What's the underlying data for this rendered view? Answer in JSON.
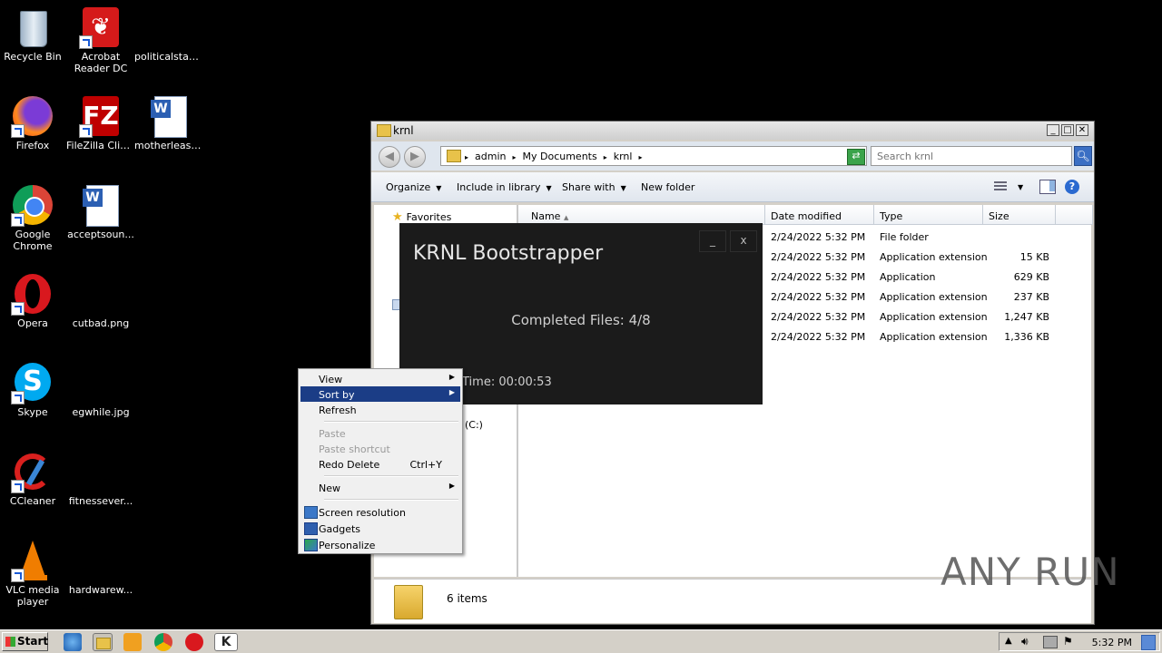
{
  "desktop": {
    "icons": [
      {
        "label": "Recycle Bin",
        "name": "recycle-bin-icon"
      },
      {
        "label": "Acrobat\nReader DC",
        "label1": "Acrobat",
        "label2": "Reader DC",
        "name": "acrobat-reader-icon"
      },
      {
        "label": "politicalstan...",
        "name": "file-icon"
      },
      {
        "label": "Firefox",
        "name": "firefox-icon"
      },
      {
        "label": "FileZilla Client",
        "name": "filezilla-icon"
      },
      {
        "label": "motherleast...",
        "name": "word-document-icon"
      },
      {
        "label1": "Google",
        "label2": "Chrome",
        "name": "chrome-icon"
      },
      {
        "label": "acceptsoun...",
        "name": "word-document-icon"
      },
      {
        "label": "Opera",
        "name": "opera-icon"
      },
      {
        "label": "cutbad.png",
        "name": "image-file-icon"
      },
      {
        "label": "Skype",
        "name": "skype-icon"
      },
      {
        "label": "egwhile.jpg",
        "name": "image-file-icon"
      },
      {
        "label": "CCleaner",
        "name": "ccleaner-icon"
      },
      {
        "label": "fitnessever...",
        "name": "file-icon"
      },
      {
        "label1": "VLC media",
        "label2": "player",
        "name": "vlc-icon"
      },
      {
        "label": "hardwarew...",
        "name": "file-icon"
      }
    ]
  },
  "explorer": {
    "title": "krnl",
    "breadcrumbs": [
      "admin",
      "My Documents",
      "krnl"
    ],
    "search_placeholder": "Search krnl",
    "commands": [
      "Organize",
      "Include in library",
      "Share with",
      "New folder"
    ],
    "nav": {
      "favorites": "Favorites",
      "drive_fragment": "(C:)"
    },
    "columns": [
      "Name",
      "Date modified",
      "Type",
      "Size"
    ],
    "rows": [
      {
        "date": "2/24/2022 5:32 PM",
        "type": "File folder",
        "size": ""
      },
      {
        "date": "2/24/2022 5:32 PM",
        "type": "Application extension",
        "size": "15 KB"
      },
      {
        "date": "2/24/2022 5:32 PM",
        "type": "Application",
        "size": "629 KB"
      },
      {
        "date": "2/24/2022 5:32 PM",
        "type": "Application extension",
        "size": "237 KB"
      },
      {
        "date": "2/24/2022 5:32 PM",
        "type": "Application extension",
        "size": "1,247 KB"
      },
      {
        "date": "2/24/2022 5:32 PM",
        "type": "Application extension",
        "size": "1,336 KB"
      }
    ],
    "item_count": "6 items"
  },
  "krnl": {
    "title": "KRNL Bootstrapper",
    "minimize": "_",
    "close": "x",
    "status": "Completed Files: 4/8",
    "time": "Time: 00:00:53"
  },
  "context_menu": {
    "items": [
      {
        "label": "View",
        "submenu": true
      },
      {
        "label": "Sort by",
        "submenu": true,
        "selected": true
      },
      {
        "label": "Refresh"
      },
      {
        "label": "Paste",
        "disabled": true
      },
      {
        "label": "Paste shortcut",
        "disabled": true
      },
      {
        "label": "Redo Delete",
        "shortcut": "Ctrl+Y"
      },
      {
        "label": "New",
        "submenu": true
      },
      {
        "label": "Screen resolution",
        "icon": "monitor-icon"
      },
      {
        "label": "Gadgets",
        "icon": "gadgets-icon"
      },
      {
        "label": "Personalize",
        "icon": "personalize-icon"
      }
    ]
  },
  "taskbar": {
    "start": "Start",
    "clock": "5:32 PM"
  },
  "watermark": "ANY RUN",
  "colors": {
    "menu_highlight": "#1b3d86",
    "krnl_bg": "#1b1b1b",
    "desktop_bg": "#000000"
  }
}
